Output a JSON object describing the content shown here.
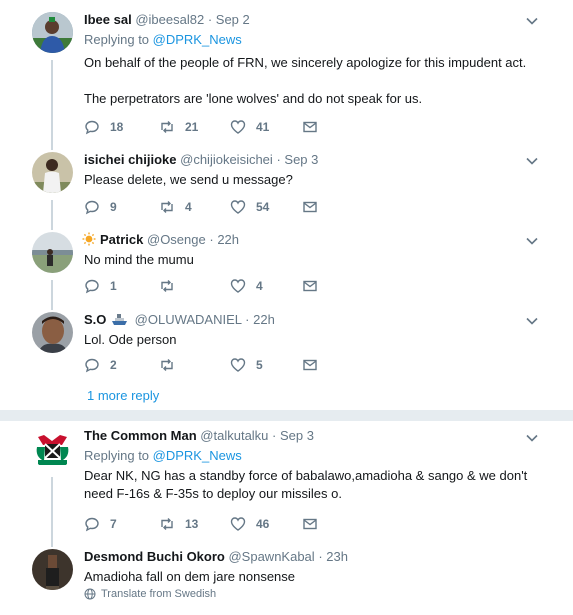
{
  "tweets": [
    {
      "name": "Ibee sal",
      "handle": "@ibeesal82",
      "time": "Sep 2",
      "replying_prefix": "Replying to ",
      "replying_to": "@DPRK_News",
      "text": "On behalf of the people of FRN, we sincerely apologize for this impudent act.\n\nThe perpetrators are 'lone wolves' and do not speak for us.",
      "replies": "18",
      "retweets": "21",
      "likes": "41"
    },
    {
      "name": "isichei chijioke",
      "handle": "@chijiokeisichei",
      "time": "Sep 3",
      "text": "Please delete, we send u message?",
      "replies": "9",
      "retweets": "4",
      "likes": "54"
    },
    {
      "name": "Patrick",
      "handle": "@Osenge",
      "time": "22h",
      "text": "No mind the mumu",
      "replies": "1",
      "retweets": "",
      "likes": "4"
    },
    {
      "name": "S.O",
      "handle": "@OLUWADANIEL",
      "time": "22h",
      "text": "Lol. Ode person",
      "replies": "2",
      "retweets": "",
      "likes": "5"
    },
    {
      "name": "The Common Man",
      "handle": "@talkutalku",
      "time": "Sep 3",
      "replying_prefix": "Replying to ",
      "replying_to": "@DPRK_News",
      "text": "Dear NK, NG has a standby force of babalawo,amadioha & sango & we don't need F-16s & F-35s to deploy our missiles o.",
      "replies": "7",
      "retweets": "13",
      "likes": "46"
    },
    {
      "name": "Desmond Buchi Okoro",
      "handle": "@SpawnKabal",
      "time": "23h",
      "text": "Amadioha fall on dem jare nonsense",
      "translate": "Translate from Swedish"
    }
  ],
  "more_replies": "1 more reply",
  "colors": {
    "accent": "#1b95e0",
    "secondary_text": "#657786",
    "separator": "#e6ecf0"
  }
}
